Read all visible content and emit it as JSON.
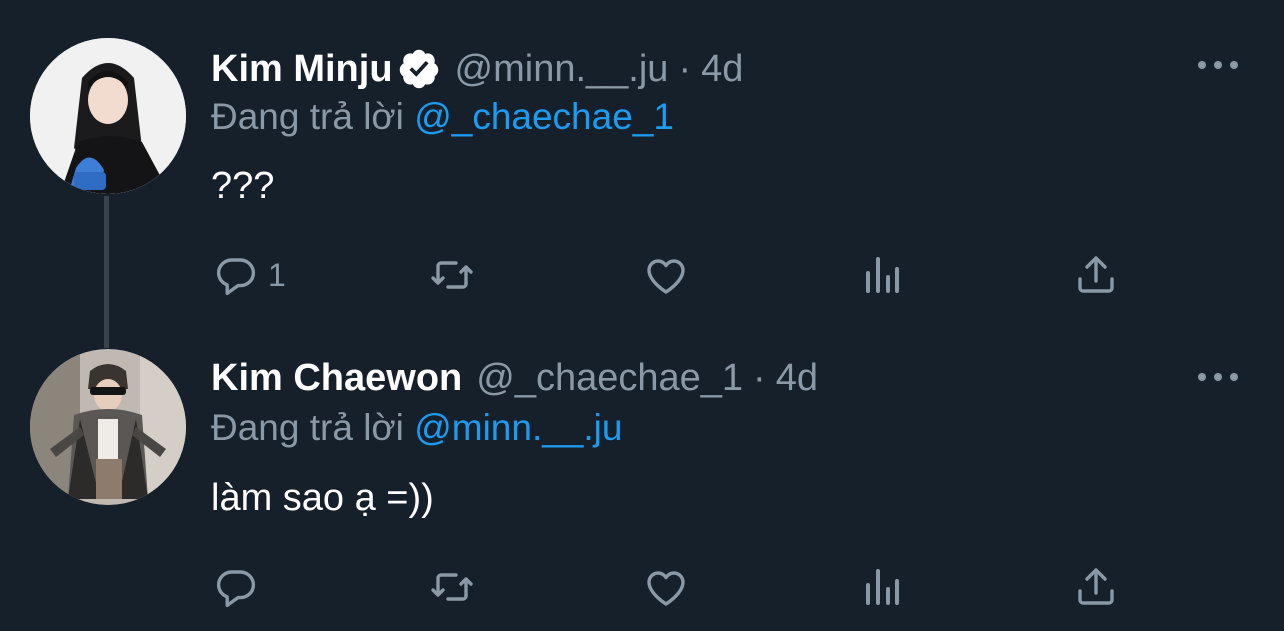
{
  "tweets": [
    {
      "display_name": "Kim Minju",
      "verified": true,
      "handle": "@minn.__.ju",
      "separator": "·",
      "time": "4d",
      "reply_prefix": "Đang trả lời",
      "reply_mention": "@_chaechae_1",
      "text": "???",
      "reply_count": "1"
    },
    {
      "display_name": "Kim Chaewon",
      "verified": false,
      "handle": "@_chaechae_1",
      "separator": "·",
      "time": "4d",
      "reply_prefix": "Đang trả lời",
      "reply_mention": "@minn.__.ju",
      "text": "làm sao ạ =))",
      "reply_count": ""
    }
  ],
  "icons": {
    "verified": "verified-badge-icon",
    "more": "more-horizontal-icon",
    "reply": "reply-icon",
    "retweet": "retweet-icon",
    "like": "heart-icon",
    "stats": "views-chart-icon",
    "share": "share-icon"
  },
  "colors": {
    "background": "#15202b",
    "muted": "#8b98a5",
    "accent": "#1d9bf0",
    "thread_line": "#38444d"
  }
}
